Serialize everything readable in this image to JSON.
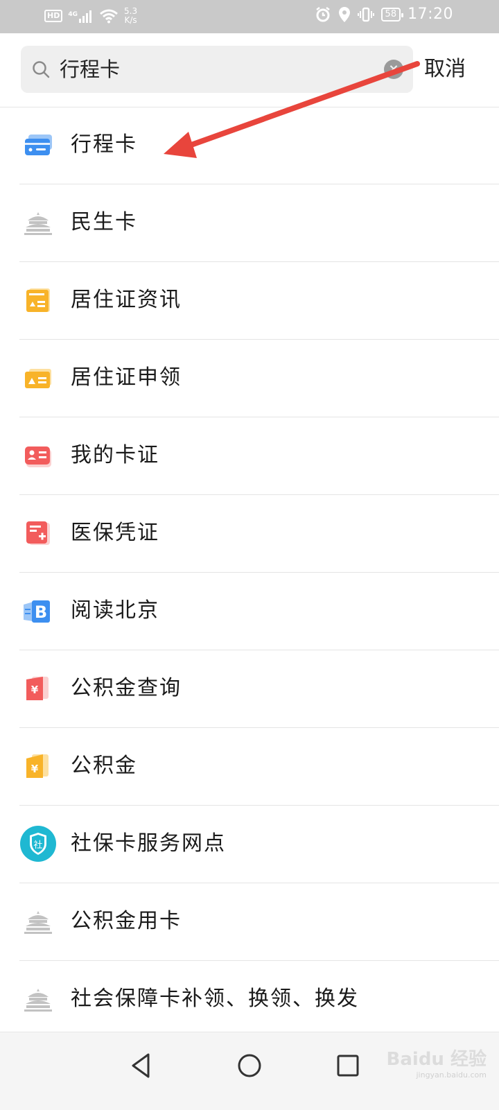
{
  "status_bar": {
    "hd": "HD",
    "network": "4G",
    "speed_value": "5.3",
    "speed_unit": "K/s",
    "battery": "58",
    "time": "17:20"
  },
  "search": {
    "query": "行程卡",
    "cancel_label": "取消"
  },
  "results": [
    {
      "label": "行程卡",
      "icon": "trip-card-icon"
    },
    {
      "label": "民生卡",
      "icon": "temple-icon"
    },
    {
      "label": "居住证资讯",
      "icon": "residence-info-icon"
    },
    {
      "label": "居住证申领",
      "icon": "residence-apply-icon"
    },
    {
      "label": "我的卡证",
      "icon": "my-cards-icon"
    },
    {
      "label": "医保凭证",
      "icon": "medical-insurance-icon"
    },
    {
      "label": "阅读北京",
      "icon": "read-beijing-icon"
    },
    {
      "label": "公积金查询",
      "icon": "fund-query-icon"
    },
    {
      "label": "公积金",
      "icon": "fund-icon"
    },
    {
      "label": "社保卡服务网点",
      "icon": "social-security-shield-icon"
    },
    {
      "label": "公积金用卡",
      "icon": "temple-icon"
    },
    {
      "label": "社会保障卡补领、换领、换发",
      "icon": "temple-icon"
    }
  ],
  "shield_badge_text": "社",
  "watermark": {
    "text": "Baidu 经验",
    "sub": "jingyan.baidu.com"
  },
  "colors": {
    "arrow": "#e8453c",
    "blue": "#3d8ff0",
    "orange": "#f8b329",
    "red": "#f25c5c",
    "teal": "#1fb8d2"
  }
}
